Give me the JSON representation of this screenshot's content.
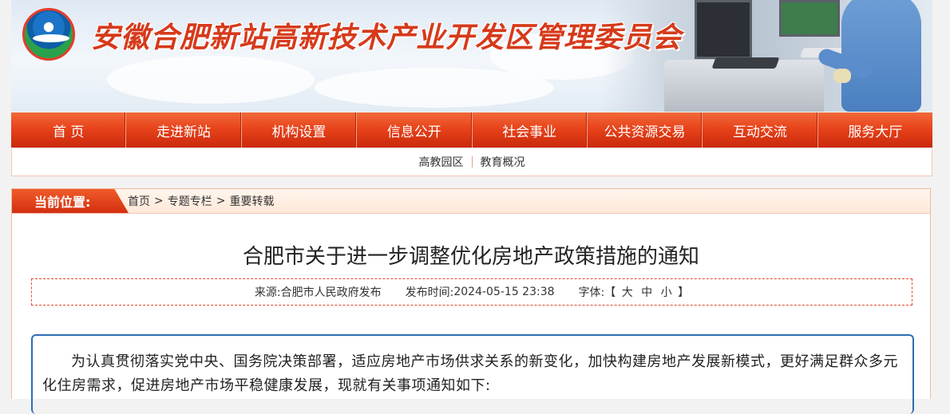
{
  "header": {
    "site_title": "安徽合肥新站高新技术产业开发区管理委员会"
  },
  "nav": {
    "items": [
      "首 页",
      "走进新站",
      "机构设置",
      "信息公开",
      "社会事业",
      "公共资源交易",
      "互动交流",
      "服务大厅"
    ]
  },
  "subnav": {
    "items": [
      "高教园区",
      "教育概况"
    ]
  },
  "location": {
    "label": "当前位置:",
    "crumbs": [
      "首页",
      "专题专栏",
      "重要转载"
    ],
    "separator": ">"
  },
  "article": {
    "title": "合肥市关于进一步调整优化房地产政策措施的通知",
    "source_label": "来源:",
    "source": "合肥市人民政府发布",
    "date_label": "发布时间:",
    "date": "2024-05-15 23:38",
    "font_label": "字体:",
    "bracket_open": "【",
    "font_large": "大",
    "font_medium": "中",
    "font_small": "小",
    "bracket_close": "】",
    "paragraph": "为认真贯彻落实党中央、国务院决策部署，适应房地产市场供求关系的新变化，加快构建房地产发展新模式，更好满足群众多元化住房需求，促进房地产市场平稳健康发展，现就有关事项通知如下:"
  },
  "colors": {
    "nav_red": "#e8431b",
    "title_red": "#d63a1b",
    "body_border_blue": "#2e6db4"
  }
}
